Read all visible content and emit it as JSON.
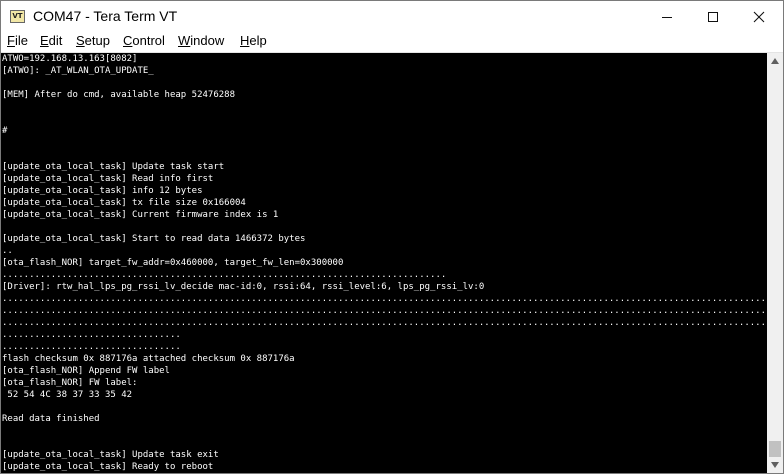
{
  "window": {
    "title": "COM47 - Tera Term VT",
    "icon_label": "VT"
  },
  "colors": {
    "terminal_bg": "#000000",
    "terminal_fg": "#ffffff",
    "titlebar_bg": "#ffffff",
    "scrollbar_bg": "#f0f0f0"
  },
  "menu": {
    "file": {
      "mnemonic": "F",
      "rest": "ile"
    },
    "edit": {
      "mnemonic": "E",
      "rest": "dit"
    },
    "setup": {
      "mnemonic": "S",
      "rest": "etup"
    },
    "control": {
      "mnemonic": "C",
      "rest": "ontrol"
    },
    "window": {
      "mnemonic": "W",
      "rest": "indow"
    },
    "help": {
      "mnemonic": "H",
      "rest": "elp"
    }
  },
  "icons": [
    "vt-app-icon",
    "minimize-icon",
    "maximize-icon",
    "close-icon",
    "scroll-up-arrow-icon",
    "scroll-down-arrow-icon"
  ],
  "terminal": {
    "lines": [
      "ATWO=192.168.13.163[8082]",
      "[ATWO]: _AT_WLAN_OTA_UPDATE_",
      "",
      "[MEM] After do cmd, available heap 52476288",
      "",
      "",
      "#",
      "",
      "",
      "[update_ota_local_task] Update task start",
      "[update_ota_local_task] Read info first",
      "[update_ota_local_task] info 12 bytes",
      "[update_ota_local_task] tx file size 0x166004",
      "[update_ota_local_task] Current firmware index is 1",
      "",
      "[update_ota_local_task] Start to read data 1466372 bytes",
      "..",
      "[ota_flash_NOR] target_fw_addr=0x460000, target_fw_len=0x300000",
      "..................................................................................",
      "[Driver]: rtw_hal_lps_pg_rssi_lv_decide mac-id:0, rssi:64, rssi_level:6, lps_pg_rssi_lv:0",
      ".....................................................................................................................................................................................",
      ".....................................................................................................................................................................................",
      ".....................................................................................................................................................................................",
      ".................................",
      ".................................",
      "flash checksum 0x 887176a attached checksum 0x 887176a",
      "[ota_flash_NOR] Append FW label",
      "[ota_flash_NOR] FW label:",
      " 52 54 4C 38 37 33 35 42",
      "",
      "Read data finished",
      "",
      "",
      "[update_ota_local_task] Update task exit",
      "[update_ota_local_task] Ready to reboot"
    ]
  }
}
